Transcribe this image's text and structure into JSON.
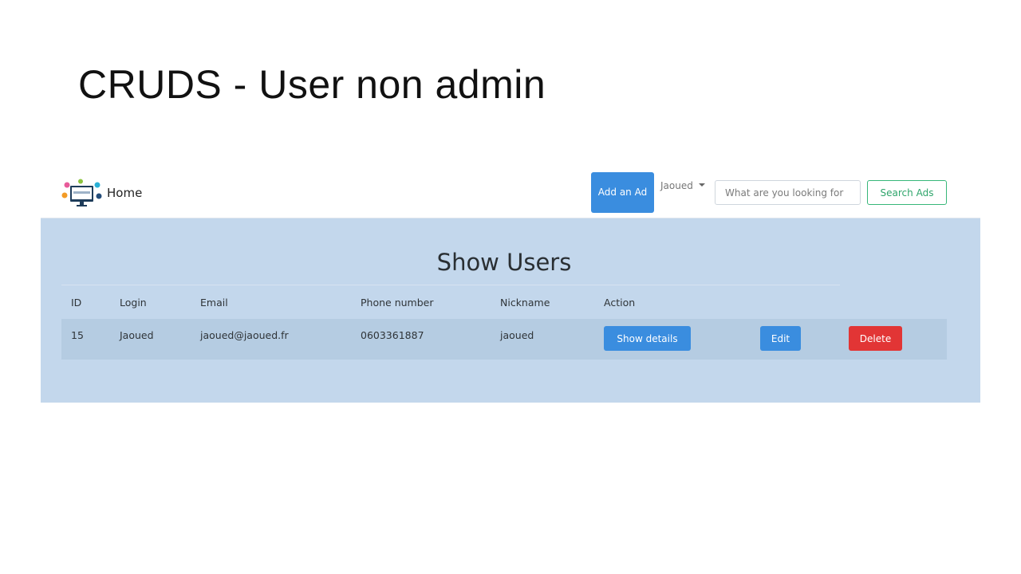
{
  "slide": {
    "title": "CRUDS - User non admin"
  },
  "navbar": {
    "brand_label": "Home",
    "logo_icon": "computer-logo-icon",
    "add_ad_label": "Add an Ad",
    "user_menu_label": "Jaoued",
    "search_placeholder": "What are you looking for",
    "search_button_label": "Search Ads"
  },
  "main": {
    "title": "Show Users",
    "table": {
      "headers": {
        "id": "ID",
        "login": "Login",
        "email": "Email",
        "phone": "Phone number",
        "nickname": "Nickname",
        "action": "Action"
      },
      "rows": [
        {
          "id": "15",
          "login": "Jaoued",
          "email": "jaoued@jaoued.fr",
          "phone": "0603361887",
          "nickname": "jaoued",
          "actions": {
            "details_label": "Show details",
            "edit_label": "Edit",
            "delete_label": "Delete"
          }
        }
      ]
    }
  },
  "colors": {
    "primary": "#3a8ddf",
    "danger": "#e23535",
    "success": "#37b779",
    "content_bg": "#c3d7ec",
    "row_bg": "#b5cce2"
  }
}
